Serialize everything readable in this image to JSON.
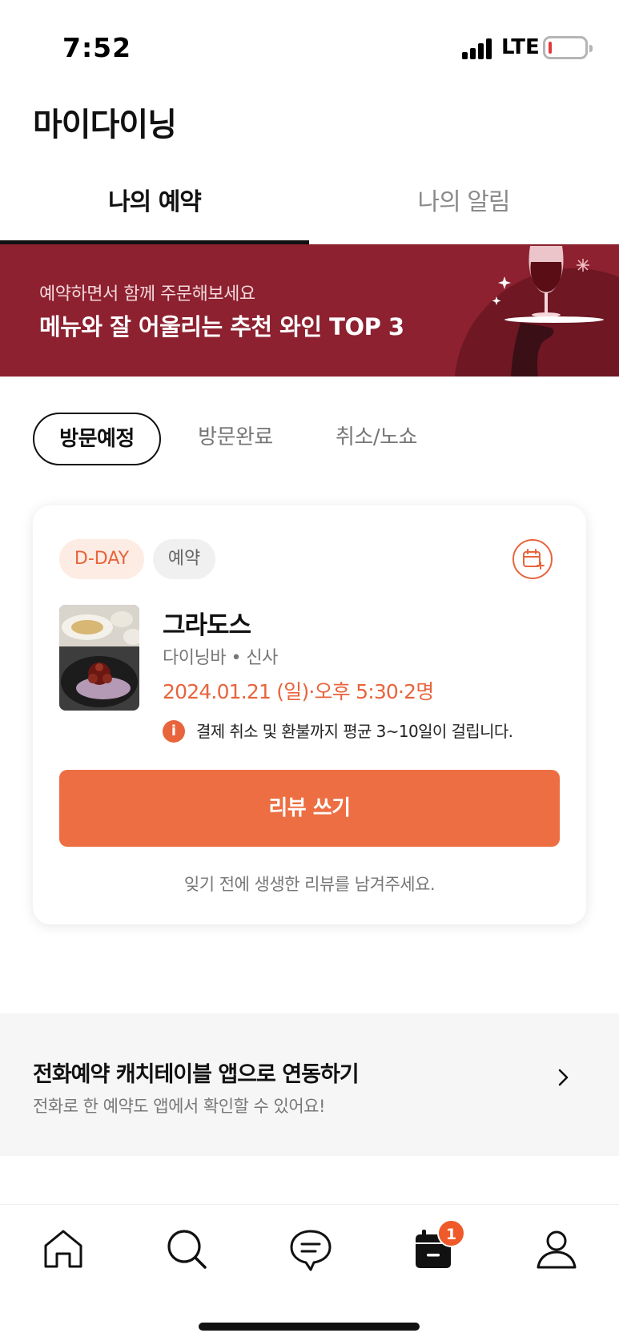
{
  "status_bar": {
    "time": "7:52",
    "network": "LTE",
    "battery_level": 0.05,
    "battery_color": "#e5383b"
  },
  "header": {
    "title": "마이다이닝"
  },
  "tabs": [
    {
      "label": "나의 예약",
      "active": true
    },
    {
      "label": "나의 알림",
      "active": false
    }
  ],
  "banner": {
    "subtitle": "예약하면서 함께 주문해보세요",
    "title": "메뉴와 잘 어울리는 추천 와인 TOP 3",
    "background": "#8d2130",
    "icon": "wine-tray-illustration"
  },
  "filters": [
    {
      "label": "방문예정",
      "active": true
    },
    {
      "label": "방문완료",
      "active": false
    },
    {
      "label": "취소/노쇼",
      "active": false
    }
  ],
  "reservation": {
    "badge_dday": "D-DAY",
    "badge_status": "예약",
    "calendar_icon": "calendar-add-icon",
    "name": "그라도스",
    "category": "다이닝바 • 신사",
    "datetime": "2024.01.21 (일)·오후 5:30·2명",
    "notice_icon": "i",
    "notice": "결제 취소 및 환불까지 평균 3~10일이 걸립니다.",
    "review_button": "리뷰 쓰기",
    "review_hint": "잊기 전에 생생한 리뷰를 남겨주세요.",
    "accent": "#ed6e42"
  },
  "link_section": {
    "title": "전화예약 캐치테이블 앱으로 연동하기",
    "subtitle": "전화로 한 예약도 앱에서 확인할 수 있어요!",
    "icon": "chevron-right-icon"
  },
  "bottom_nav": {
    "items": [
      {
        "icon": "home-icon"
      },
      {
        "icon": "search-icon"
      },
      {
        "icon": "chat-icon"
      },
      {
        "icon": "calendar-icon",
        "badge": "1"
      },
      {
        "icon": "profile-icon"
      }
    ]
  }
}
